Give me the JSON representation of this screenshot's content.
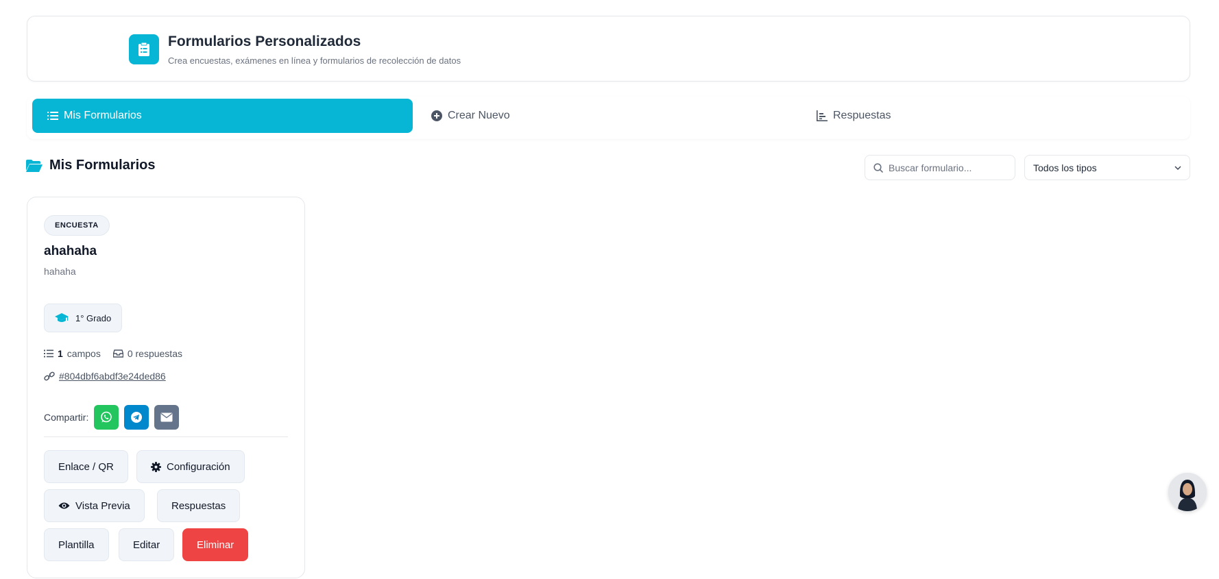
{
  "header": {
    "title": "Formularios Personalizados",
    "subtitle": "Crea encuestas, exámenes en línea y formularios de recolección de datos"
  },
  "tabs": [
    {
      "label": "Mis Formularios",
      "active": true
    },
    {
      "label": "Crear Nuevo",
      "active": false
    },
    {
      "label": "Respuestas",
      "active": false
    }
  ],
  "section": {
    "title": "Mis Formularios",
    "search_placeholder": "Buscar formulario...",
    "type_filter": "Todos los tipos"
  },
  "form": {
    "type_badge": "ENCUESTA",
    "title": "ahahaha",
    "description": "hahaha",
    "grade": "1° Grado",
    "fields_count": "1",
    "fields_label": "campos",
    "responses_label": "0 respuestas",
    "link_id": "#804dbf6abdf3e24ded86",
    "share_label": "Compartir:",
    "actions": {
      "link_qr": "Enlace / QR",
      "settings": "Configuración",
      "preview": "Vista Previa",
      "responses": "Respuestas",
      "template": "Plantilla",
      "edit": "Editar",
      "delete": "Eliminar"
    }
  },
  "colors": {
    "accent": "#06b6d4",
    "whatsapp": "#22c55e",
    "telegram": "#0088cc",
    "email": "#64748b",
    "danger": "#ef4444"
  }
}
